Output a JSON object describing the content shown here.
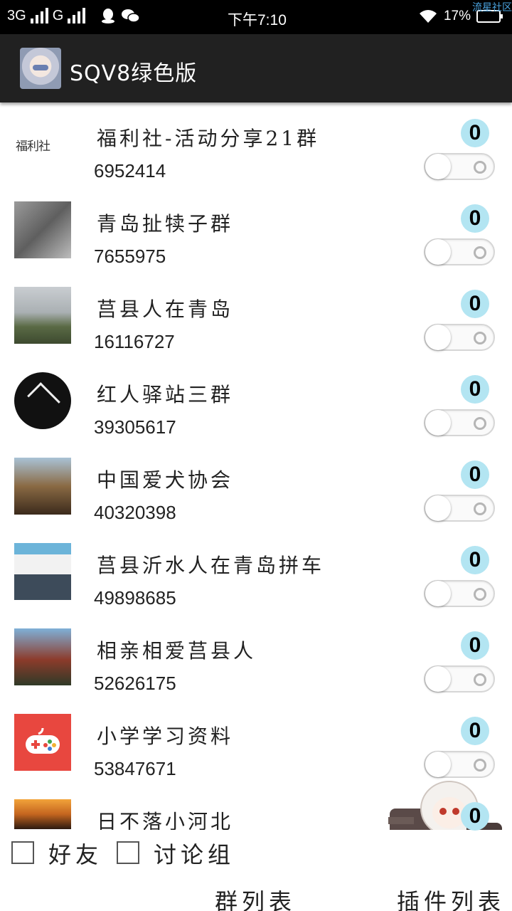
{
  "status_bar": {
    "network1": "3G",
    "network2": "G",
    "time": "下午7:10",
    "battery": "17%",
    "watermark": "流星社区"
  },
  "app_bar": {
    "title": "SQV8绿色版"
  },
  "groups": [
    {
      "name": "福利社-活动分享21群",
      "number": "6952414",
      "badge": "0",
      "enabled": false
    },
    {
      "name": "青岛扯犊子群",
      "number": "7655975",
      "badge": "0",
      "enabled": false
    },
    {
      "name": "莒县人在青岛",
      "number": "16116727",
      "badge": "0",
      "enabled": false
    },
    {
      "name": "红人驿站三群",
      "number": "39305617",
      "badge": "0",
      "enabled": false
    },
    {
      "name": "中国爱犬协会",
      "number": "40320398",
      "badge": "0",
      "enabled": false
    },
    {
      "name": "莒县沂水人在青岛拼车",
      "number": "49898685",
      "badge": "0",
      "enabled": false
    },
    {
      "name": "相亲相爱莒县人",
      "number": "52626175",
      "badge": "0",
      "enabled": false
    },
    {
      "name": "小学学习资料",
      "number": "53847671",
      "badge": "0",
      "enabled": false
    },
    {
      "name": "日不落小河北",
      "number": "",
      "badge": "0",
      "enabled": false
    }
  ],
  "avatar_texts": {
    "fuli": "福利社"
  },
  "bottom": {
    "friends_label": "好友",
    "discussion_label": "讨论组",
    "tab_groups": "群列表",
    "tab_plugins": "插件列表"
  },
  "colors": {
    "app_bar": "#212121",
    "badge_bg": "#b3e5f2",
    "status_bar": "#000000"
  }
}
